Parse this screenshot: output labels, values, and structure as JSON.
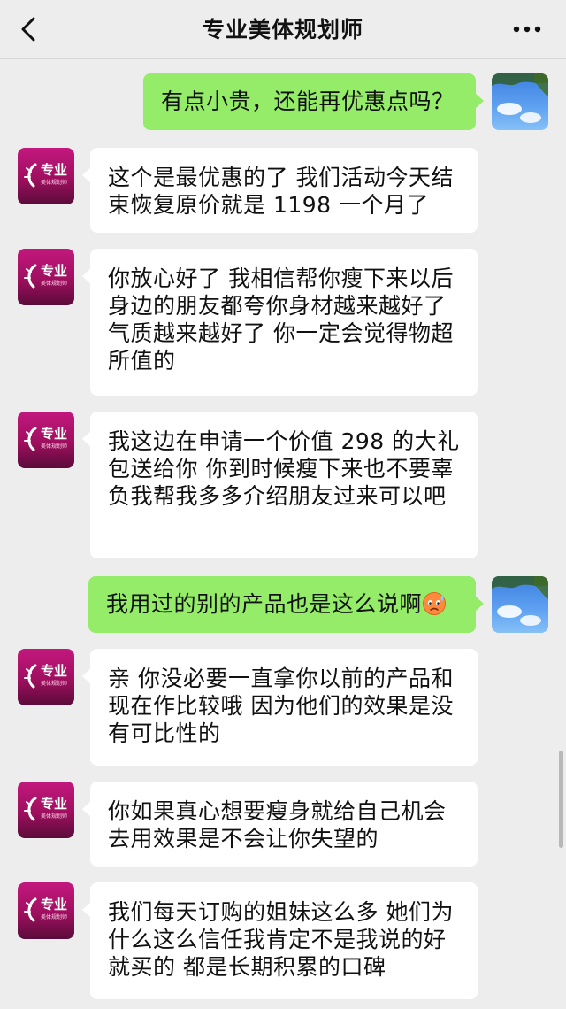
{
  "header": {
    "title": "专业美体规划师",
    "back_icon": "back-chevron-icon",
    "more_icon": "more-dots-icon"
  },
  "brand_avatar": {
    "text": "专业",
    "subtext": "美体规划师"
  },
  "colors": {
    "background": "#ededed",
    "incoming_bubble": "#ffffff",
    "outgoing_bubble": "#95ec69",
    "brand": "#c3187e"
  },
  "messages": [
    {
      "from": "me",
      "text": "有点小贵，还能再优惠点吗？"
    },
    {
      "from": "them",
      "text": "这个是最优惠的了 我们活动今天结束恢复原价就是 1198 一个月了"
    },
    {
      "from": "them",
      "text": "你放心好了 我相信帮你瘦下来以后身边的朋友都夸你身材越来越好了 气质越来越好了 你一定会觉得物超所值的"
    },
    {
      "from": "them",
      "text": "我这边在申请一个价值 298 的大礼包送给你 你到时候瘦下来也不要辜负我帮我多多介绍朋友过来可以吧"
    },
    {
      "from": "me",
      "text": "我用过的别的产品也是这么说啊",
      "emoji": "worried-sweat-emoji"
    },
    {
      "from": "them",
      "text": "亲 你没必要一直拿你以前的产品和现在作比较哦 因为他们的效果是没有可比性的"
    },
    {
      "from": "them",
      "text": "你如果真心想要瘦身就给自己机会去用效果是不会让你失望的"
    },
    {
      "from": "them",
      "text": "我们每天订购的姐妹这么多 她们为什么这么信任我肯定不是我说的好就买的 都是长期积累的口碑"
    }
  ]
}
